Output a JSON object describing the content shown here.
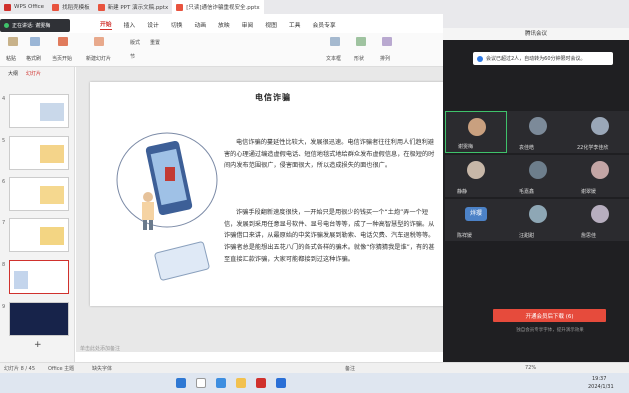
{
  "tabs": [
    {
      "label": "WPS Office",
      "color": "#d0312d"
    },
    {
      "label": "找稻壳模板",
      "color": "#d0312d"
    },
    {
      "label": "新建 PPT 演示文稿.pptx",
      "color": "#d0312d"
    },
    {
      "label": "[只读]通信诈骗重视安全.pptx",
      "color": "#d0312d"
    }
  ],
  "recording": {
    "label": "正在讲话: 谢雯梅"
  },
  "ribbon_tabs": [
    "开始",
    "插入",
    "设计",
    "切换",
    "动画",
    "放映",
    "审阅",
    "视图",
    "工具",
    "会员专享"
  ],
  "ribbon_selected": "开始",
  "ribbon": {
    "paste": "粘贴",
    "format_painter": "格式刷",
    "from_start": "当页开始",
    "new_slide": "新建幻灯片",
    "layout": "版式",
    "section": "节",
    "reset": "重置",
    "text_box": "文本框",
    "shape": "形状",
    "arrange": "排列"
  },
  "left_panel": {
    "tab_outline": "大纲",
    "tab_slides": "幻灯片",
    "slide_numbers": [
      "4",
      "5",
      "6",
      "7",
      "8",
      "9"
    ]
  },
  "slide": {
    "title": "电信诈骗",
    "paragraph1": "电信诈骗的蔓延性比较大，发展很迅速。电信诈骗者往往利用人们趋利避害的心理通过编造虚假电话、短信地毯式地给群众发布虚假信息，在极短的时间内发布范围很广，侵害面很大，所以造成损失的面也很广。",
    "paragraph2": "诈骗手段翻新速度很快，一开始只是用很少的钱买一个“土炮”弄一个短信，发展到采用任意显号软件、显号电台等等，成了一种高智慧型的诈骗。从诈骗借口来讲，从最原始的中奖诈骗发展到勒索、电话欠费、汽车退税等等。诈骗者总是能想出五花八门的各式各样的骗术。就像“你猜猜我是谁”，有的甚至直接汇款诈骗，大家可能都接到过这种诈骗。"
  },
  "notes_placeholder": "单击此处添加备注",
  "status": {
    "slide_count": "幻灯片 8 / 45",
    "theme": "Office 主题",
    "missing_font": "缺失字体",
    "notes": "备注",
    "zoom": "72%"
  },
  "meeting": {
    "title": "腾讯会议",
    "notice": "会议已超过2人，自动转为60分钟限时会议。",
    "participants": [
      {
        "name": "谢雯梅",
        "color": "#c9a07f"
      },
      {
        "name": "袁佳皓",
        "color": "#7c8a99"
      },
      {
        "name": "22化学李佳欣",
        "color": "#9aa7b8"
      },
      {
        "name": "静静",
        "color": "#c7b7a8"
      },
      {
        "name": "毛嘉鑫",
        "color": "#6d7e8c"
      },
      {
        "name": "谢翠媛",
        "color": "#c3a5a5"
      },
      {
        "name": "陈祥媛",
        "color": "#4c82c7"
      },
      {
        "name": "汪甜甜",
        "color": "#8ea7b5"
      },
      {
        "name": "詹思佳",
        "color": "#b7aebf"
      }
    ],
    "avatar_text": "烊璎",
    "download_button": "开通会员后下载 (6)",
    "download_sub": "独自会员专享字体，提升演示效果"
  },
  "taskbar": {
    "time": "19:37",
    "date": "2024/1/31"
  },
  "colors": {
    "accent": "#d0312d",
    "meeting_bg": "#1f1f22",
    "download": "#e64b3c"
  }
}
